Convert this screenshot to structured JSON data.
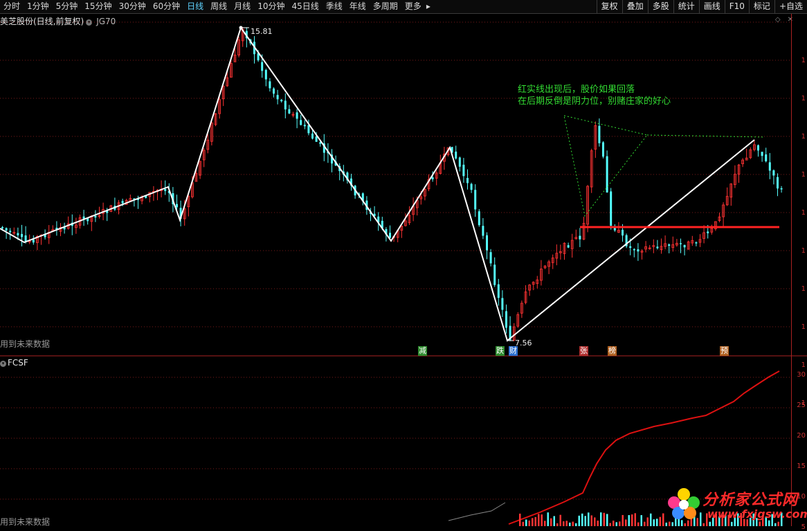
{
  "toolbar": {
    "periods": [
      "分时",
      "1分钟",
      "5分钟",
      "15分钟",
      "30分钟",
      "60分钟",
      "日线",
      "周线",
      "月线",
      "10分钟",
      "45日线",
      "季线",
      "年线",
      "多周期",
      "更多"
    ],
    "active_period": "日线",
    "more_arrow": "▸",
    "right_buttons": [
      "复权",
      "叠加",
      "多股",
      "统计",
      "画线",
      "F10",
      "标记",
      "+自选"
    ]
  },
  "main_chart": {
    "title": "美芝股份(日线,前复权)",
    "indicator": "JG70",
    "high_label": "15.81",
    "low_label": "7.56",
    "warning": "用到未来数据",
    "annotation_line1": "红实线出现后，股价如果回落",
    "annotation_line2": "在后期反倒是阴力位，别赌庄家的好心",
    "signals": [
      {
        "text": "减",
        "color": "#2e8b2e"
      },
      {
        "text": "跌",
        "color": "#2e8b2e"
      },
      {
        "text": "财",
        "color": "#2a6fd0"
      },
      {
        "text": "张",
        "color": "#b03030"
      },
      {
        "text": "榜",
        "color": "#b06020"
      },
      {
        "text": "预",
        "color": "#b06020"
      }
    ],
    "right_axis_labels": [
      "1",
      "1",
      "1",
      "1",
      "1",
      "1",
      "1",
      "1",
      "1",
      "1"
    ]
  },
  "sub_chart": {
    "title": "FCSF",
    "warning": "用到未来数据",
    "right_axis_labels": [
      "30",
      "25",
      "20",
      "15",
      "10",
      "5"
    ]
  },
  "colors": {
    "up": "#ff3333",
    "down": "#54ffff",
    "zigzag": "#ffffff",
    "resistance": "#ff2222",
    "annotation": "#33dd33",
    "grid": "#7a1a1a",
    "active_tab": "#5fd3ff"
  },
  "watermark": {
    "brand": "分析家公式网",
    "url": "www.fxjgsw.com"
  }
}
